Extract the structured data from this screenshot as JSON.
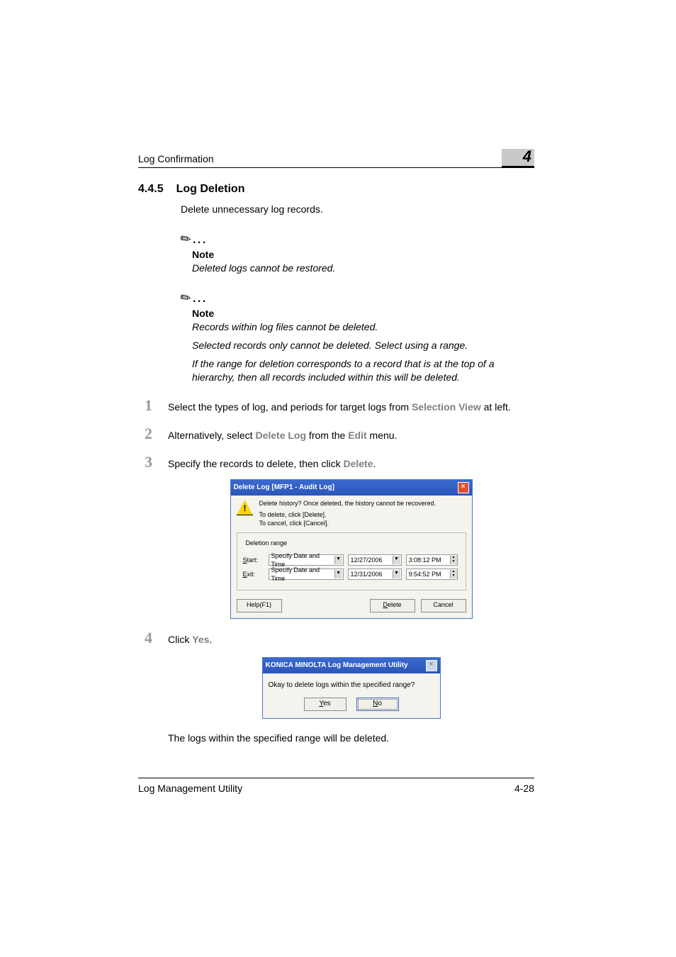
{
  "header": {
    "title": "Log Confirmation",
    "chapter": "4"
  },
  "section": {
    "num": "4.4.5",
    "title": "Log Deletion"
  },
  "intro": "Delete unnecessary log records.",
  "note1": {
    "label": "Note",
    "text": "Deleted logs cannot be restored."
  },
  "note2": {
    "label": "Note",
    "p1": "Records within log files cannot be deleted.",
    "p2": "Selected records only cannot be deleted. Select using a range.",
    "p3": "If the range for deletion corresponds to a record that is at the top of a hierarchy, then all records included within this will be deleted."
  },
  "steps": {
    "s1a": "Select the types of log, and periods for target logs from ",
    "s1_sel": "Selection View",
    "s1b": " at left.",
    "s2a": "Alternatively, select ",
    "s2_dl": "Delete Log",
    "s2b": " from the ",
    "s2_edit": "Edit",
    "s2c": " menu.",
    "s3a": "Specify the records to delete, then click ",
    "s3_del": "Delete",
    "s3b": ".",
    "s4a": "Click ",
    "s4_yes": "Yes",
    "s4b": "."
  },
  "dlg1": {
    "title": "Delete Log [MFP1 - Audit Log]",
    "msg1": "Delete history? Once deleted, the history cannot be recovered.",
    "msg2": "To delete, click [Delete].",
    "msg3": "To cancel, click [Cancel].",
    "legend": "Deletion range",
    "start_label": "Start:",
    "exit_label": "Exit:",
    "specify": "Specify Date and Time",
    "start_date": "12/27/2006",
    "start_time": "3:08:12 PM",
    "exit_date": "12/31/2006",
    "exit_time": "9:54:52 PM",
    "help": "Help(F1)",
    "delete": "Delete",
    "cancel": "Cancel"
  },
  "dlg2": {
    "title": "KONICA MINOLTA Log Management Utility",
    "msg": "Okay to delete logs within the specified range?",
    "yes": "Yes",
    "no": "No"
  },
  "closing": "The logs within the specified range will be deleted.",
  "footer": {
    "left": "Log Management Utility",
    "right": "4-28"
  }
}
